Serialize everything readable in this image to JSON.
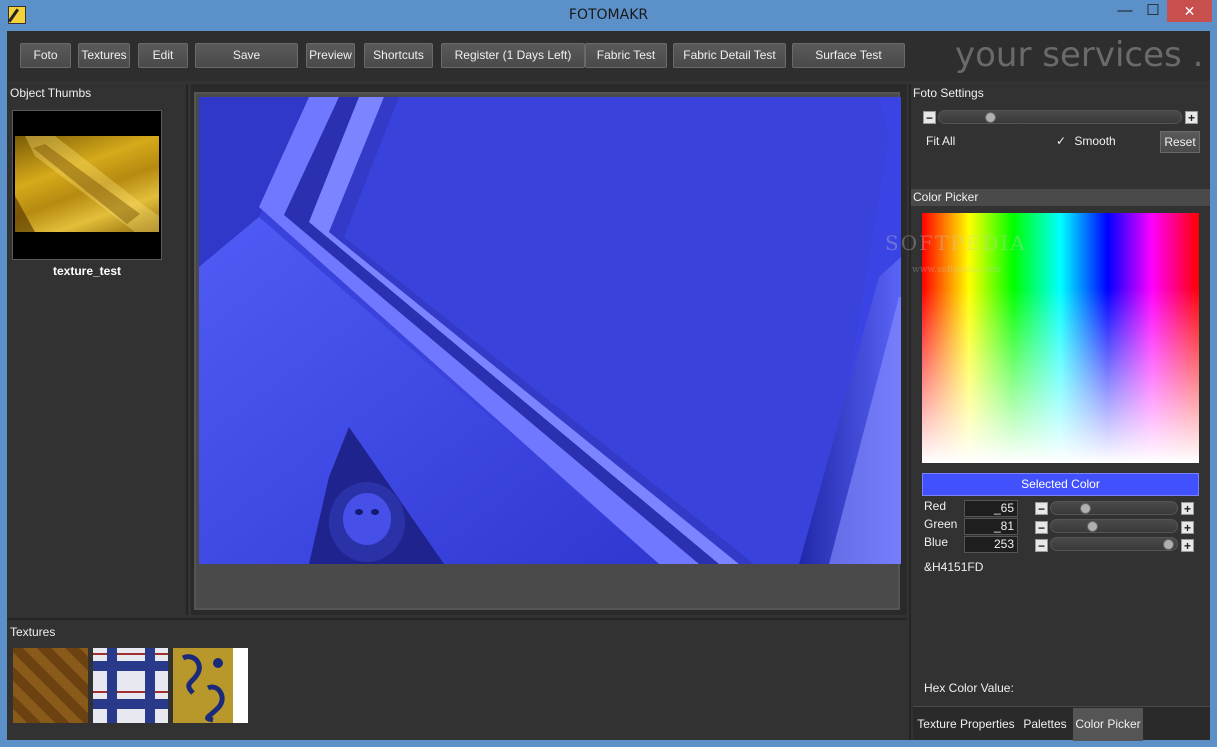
{
  "window": {
    "title": "FOTOMAKR",
    "min_glyph": "—",
    "max_glyph": "☐",
    "close_glyph": "✕"
  },
  "toolbar": {
    "buttons": [
      "Foto",
      "Textures",
      "Edit",
      "Save",
      "Preview",
      "Shortcuts",
      "Register (1 Days Left)",
      "Fabric Test",
      "Fabric Detail Test",
      "Surface Test"
    ],
    "brand": "your services . ."
  },
  "object_thumbs": {
    "label": "Object Thumbs",
    "items": [
      {
        "name": "texture_test"
      }
    ]
  },
  "textures": {
    "label": "Textures",
    "items": [
      "parquet-texture",
      "plaid-texture",
      "floral-texture"
    ]
  },
  "foto_settings": {
    "label": "Foto Settings",
    "zoom_level": 0.2,
    "fit_all_label": "Fit All",
    "smooth_label": "Smooth",
    "smooth_checked": true,
    "reset_label": "Reset"
  },
  "color_picker": {
    "label": "Color Picker",
    "selected_color_label": "Selected Color",
    "selected_color": "#4151FD",
    "red_label": "Red",
    "red_value": "_65",
    "red_level": 0.255,
    "green_label": "Green",
    "green_value": "_81",
    "green_level": 0.318,
    "blue_label": "Blue",
    "blue_value": "253",
    "blue_level": 0.992,
    "hex_text": "&H4151FD",
    "hex_label": "Hex Color Value:"
  },
  "tabs": [
    {
      "label": "Texture Properties",
      "active": false
    },
    {
      "label": "Palettes",
      "active": false
    },
    {
      "label": "Color Picker",
      "active": true
    }
  ],
  "watermark": {
    "text": "SOFTPEDIA",
    "sub": "www.softpedia.com"
  },
  "colors": {
    "photo_tint": "#3b45e6",
    "window_frame": "#5b90c8",
    "panel_bg": "#333333"
  }
}
